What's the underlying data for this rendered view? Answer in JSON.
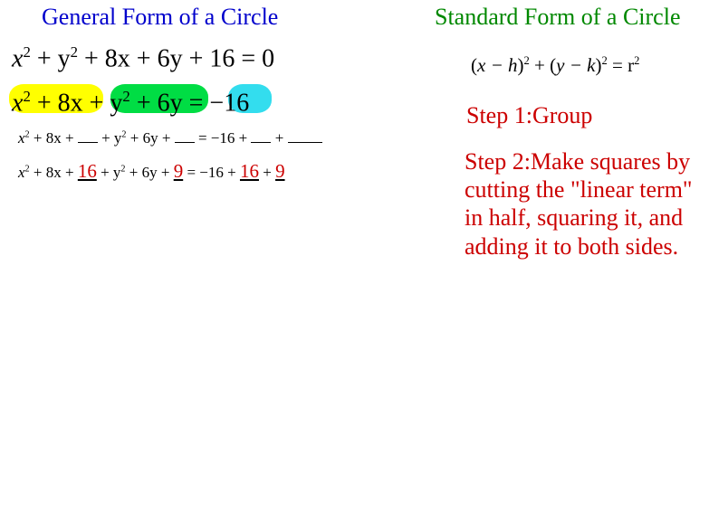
{
  "titles": {
    "general": "General Form of a Circle",
    "standard": "Standard Form of a Circle"
  },
  "equations": {
    "eq1_p1": "x",
    "eq1_p2": " + y",
    "eq1_p3": " + 8x + 6y + 16 = 0",
    "eq2_p1": "x",
    "eq2_p2": " + 8x",
    "eq2_p3": " + y",
    "eq2_p4": " + 6y",
    "eq2_p5": " = −16",
    "eq3_p1": "x",
    "eq3_p2": " + 8x + ",
    "eq3_p3": " + y",
    "eq3_p4": " + 6y + ",
    "eq3_p5": " = −16 + ",
    "eq3_p6": " + ",
    "eq4_p1": "x",
    "eq4_p2": " + 8x + ",
    "eq4_fill1": "16",
    "eq4_p3": " + y",
    "eq4_p4": " + 6y + ",
    "eq4_fill2": "9",
    "eq4_p5": " = −16 + ",
    "eq4_fill3": "16",
    "eq4_p6": " + ",
    "eq4_fill4": " 9  ",
    "standard_p1": "(",
    "standard_p2": "x − h",
    "standard_p3": ")",
    "standard_p4": " + (",
    "standard_p5": "y − k",
    "standard_p6": ")",
    "standard_p7": " = r",
    "exp2": "2"
  },
  "steps": {
    "step1": "Step 1:Group",
    "step2": "Step 2:Make squares by cutting the \"linear term\" in half, squaring it, and adding it to both sides."
  }
}
